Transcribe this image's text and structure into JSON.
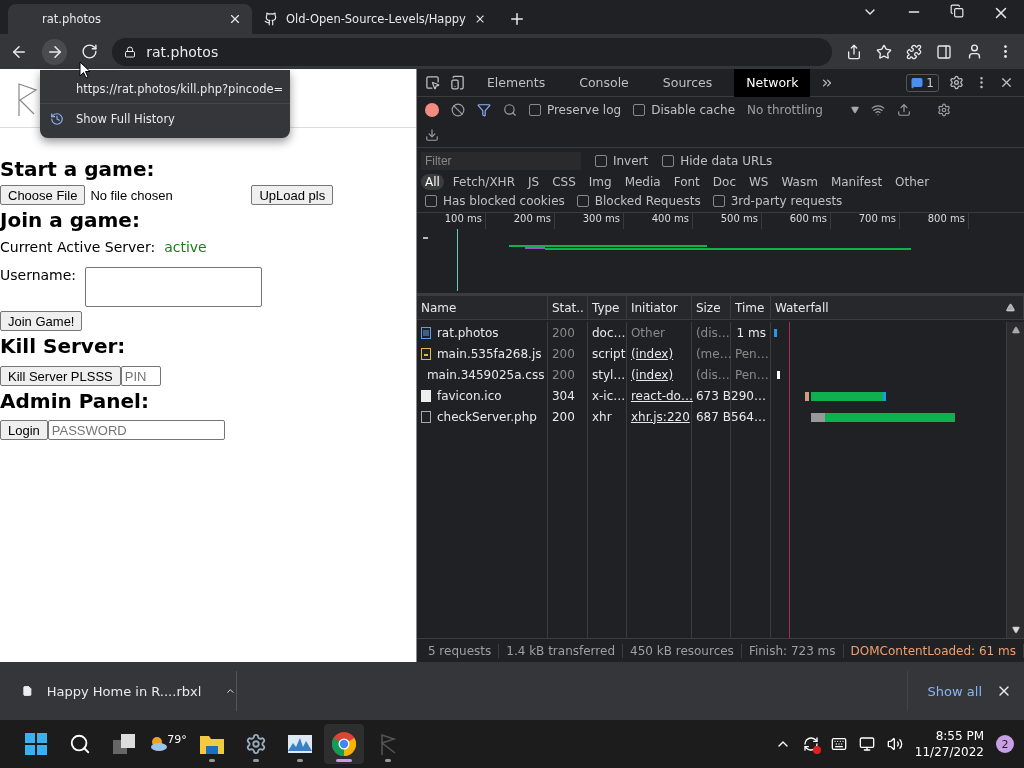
{
  "browser": {
    "tabs": [
      {
        "title": "rat.photos",
        "selected": true,
        "kind": "site"
      },
      {
        "title": "Old-Open-Source-Levels/Happy",
        "selected": false,
        "kind": "github"
      }
    ],
    "address": "rat.photos",
    "history_menu": [
      {
        "label": "https://rat.photos/kill.php?pincode=",
        "kind": "url"
      },
      {
        "label": "Show Full History",
        "kind": "history"
      }
    ]
  },
  "page": {
    "start": {
      "heading": "Start a game:",
      "choose_button": "Choose File",
      "file_status": "No file chosen",
      "upload_button": "UpLoad pls"
    },
    "join": {
      "heading": "Join a game:",
      "server_label": "Current Active Server:",
      "server_status": "active",
      "username_label": "Username:",
      "join_button": "Join Game!"
    },
    "kill": {
      "heading": "Kill Server:",
      "button": "Kill Server PLSSS",
      "pin_placeholder": "PIN"
    },
    "admin": {
      "heading": "Admin Panel:",
      "button": "Login",
      "password_placeholder": "PASSWORD"
    }
  },
  "devtools": {
    "tabs": [
      {
        "label": "Elements",
        "selected": false
      },
      {
        "label": "Console",
        "selected": false
      },
      {
        "label": "Sources",
        "selected": false
      },
      {
        "label": "Network",
        "selected": true
      }
    ],
    "issues": "1",
    "preserve_log": {
      "label": "Preserve log",
      "checked": false
    },
    "disable_cache": {
      "label": "Disable cache",
      "checked": false
    },
    "throttling": "No throttling",
    "filter_placeholder": "Filter",
    "invert": {
      "label": "Invert",
      "checked": false
    },
    "hide_data_urls": {
      "label": "Hide data URLs",
      "checked": false
    },
    "type_filters": [
      {
        "label": "All",
        "selected": true
      },
      {
        "label": "Fetch/XHR",
        "selected": false
      },
      {
        "label": "JS",
        "selected": false
      },
      {
        "label": "CSS",
        "selected": false
      },
      {
        "label": "Img",
        "selected": false
      },
      {
        "label": "Media",
        "selected": false
      },
      {
        "label": "Font",
        "selected": false
      },
      {
        "label": "Doc",
        "selected": false
      },
      {
        "label": "WS",
        "selected": false
      },
      {
        "label": "Wasm",
        "selected": false
      },
      {
        "label": "Manifest",
        "selected": false
      },
      {
        "label": "Other",
        "selected": false
      }
    ],
    "request_filters": [
      {
        "label": "Has blocked cookies",
        "checked": false
      },
      {
        "label": "Blocked Requests",
        "checked": false
      },
      {
        "label": "3rd-party requests",
        "checked": false
      }
    ],
    "timeline_ticks": [
      "100 ms",
      "200 ms",
      "300 ms",
      "400 ms",
      "500 ms",
      "600 ms",
      "700 ms",
      "800 ms"
    ],
    "columns": [
      "Name",
      "Stat..",
      "Type",
      "Initiator",
      "Size",
      "Time",
      "Waterfall"
    ],
    "rows": [
      {
        "name": "rat.photos",
        "status": "200",
        "type": "doc…",
        "initiator": "Other",
        "size": "(dis…",
        "time": "1 ms",
        "kind": "doc",
        "cached": true,
        "initiator_link": false,
        "pending": false
      },
      {
        "name": "main.535fa268.js",
        "status": "200",
        "type": "script",
        "initiator": "(index)",
        "size": "(me…",
        "time": "Pen…",
        "kind": "script",
        "cached": true,
        "initiator_link": true,
        "pending": true
      },
      {
        "name": "main.3459025a.css",
        "status": "200",
        "type": "styl…",
        "initiator": "(index)",
        "size": "(dis…",
        "time": "Pen…",
        "kind": "css",
        "cached": true,
        "initiator_link": true,
        "pending": true
      },
      {
        "name": "favicon.ico",
        "status": "304",
        "type": "x-ic…",
        "initiator": "react-do…",
        "size": "673 B",
        "time": "290…",
        "kind": "image",
        "cached": false,
        "initiator_link": true,
        "pending": false
      },
      {
        "name": "checkServer.php",
        "status": "200",
        "type": "xhr",
        "initiator": "xhr.js:220",
        "size": "687 B",
        "time": "564…",
        "kind": "xhr",
        "cached": false,
        "initiator_link": true,
        "pending": false
      }
    ],
    "summary": [
      {
        "text": "5 requests",
        "kind": "plain"
      },
      {
        "text": "1.4 kB transferred",
        "kind": "plain"
      },
      {
        "text": "450 kB resources",
        "kind": "plain"
      },
      {
        "text": "Finish: 723 ms",
        "kind": "plain"
      },
      {
        "text": "DOMContentLoaded: 61 ms",
        "kind": "dom"
      }
    ]
  },
  "download_bar": {
    "file": "Happy Home in R....rbxl",
    "show_all": "Show all"
  },
  "taskbar": {
    "apps": [
      {
        "kind": "start",
        "running": false,
        "selected": false
      },
      {
        "kind": "search",
        "running": false,
        "selected": false
      },
      {
        "kind": "taskview",
        "running": false,
        "selected": false
      },
      {
        "kind": "weather",
        "label": "79°",
        "running": false,
        "selected": false
      },
      {
        "kind": "explorer",
        "running": true,
        "selected": false
      },
      {
        "kind": "settings",
        "running": true,
        "selected": false
      },
      {
        "kind": "monitor",
        "running": true,
        "selected": false
      },
      {
        "kind": "chrome",
        "running": true,
        "selected": true
      },
      {
        "kind": "rat",
        "running": true,
        "selected": false
      }
    ],
    "time": "8:55 PM",
    "date": "11/27/2022",
    "notifications": "2"
  }
}
